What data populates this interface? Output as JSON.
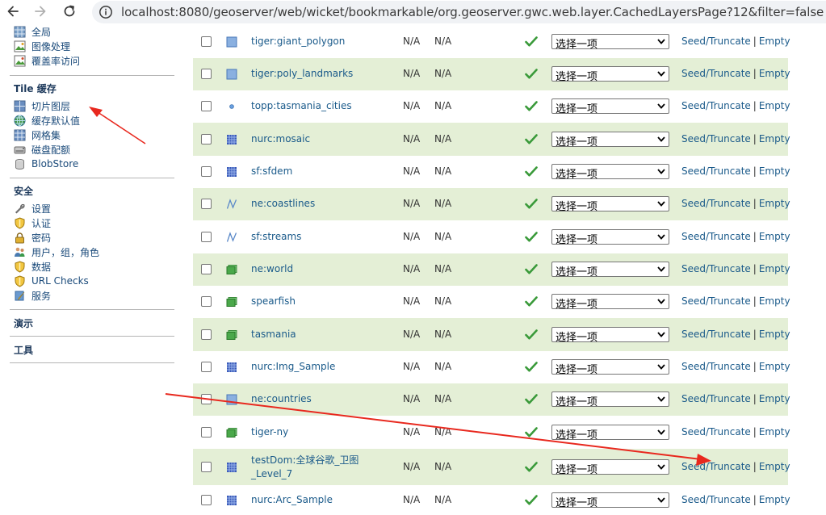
{
  "browser": {
    "url": "localhost:8080/geoserver/web/wicket/bookmarkable/org.geoserver.gwc.web.layer.CachedLayersPage?12&filter=false"
  },
  "sidebar": {
    "top_items": [
      {
        "label": "全局",
        "icon": "globe-icon"
      },
      {
        "label": "图像处理",
        "icon": "image-icon"
      },
      {
        "label": "覆盖率访问",
        "icon": "coverage-icon"
      }
    ],
    "tile_heading": "Tile 缓存",
    "tile_items": [
      {
        "label": "切片图层",
        "icon": "tile-layers-icon"
      },
      {
        "label": "缓存默认值",
        "icon": "globe-icon"
      },
      {
        "label": "网格集",
        "icon": "grid-icon"
      },
      {
        "label": "磁盘配额",
        "icon": "disk-icon"
      },
      {
        "label": "BlobStore",
        "icon": "blobstore-icon"
      }
    ],
    "security_heading": "安全",
    "security_items": [
      {
        "label": "设置",
        "icon": "wrench-icon"
      },
      {
        "label": "认证",
        "icon": "shield-icon"
      },
      {
        "label": "密码",
        "icon": "lock-icon"
      },
      {
        "label": "用户，组，角色",
        "icon": "users-icon"
      },
      {
        "label": "数据",
        "icon": "shield-icon"
      },
      {
        "label": "URL Checks",
        "icon": "shield-icon"
      },
      {
        "label": "服务",
        "icon": "service-icon"
      }
    ],
    "demo_heading": "演示",
    "tools_heading": "工具"
  },
  "table": {
    "select_placeholder": "选择一项",
    "seed_label": "Seed/Truncate",
    "separator": "|",
    "empty_label": "Empty",
    "rows": [
      {
        "name": "tiger:giant_polygon",
        "name2": "",
        "icon": "polygon-icon",
        "c1": "N/A",
        "c2": "N/A"
      },
      {
        "name": "tiger:poly_landmarks",
        "name2": "",
        "icon": "polygon-icon",
        "c1": "N/A",
        "c2": "N/A"
      },
      {
        "name": "topp:tasmania_cities",
        "name2": "",
        "icon": "point-icon",
        "c1": "N/A",
        "c2": "N/A"
      },
      {
        "name": "nurc:mosaic",
        "name2": "",
        "icon": "raster-icon",
        "c1": "N/A",
        "c2": "N/A"
      },
      {
        "name": "sf:sfdem",
        "name2": "",
        "icon": "raster-icon",
        "c1": "N/A",
        "c2": "N/A"
      },
      {
        "name": "ne:coastlines",
        "name2": "",
        "icon": "line-icon",
        "c1": "N/A",
        "c2": "N/A"
      },
      {
        "name": "sf:streams",
        "name2": "",
        "icon": "line-icon",
        "c1": "N/A",
        "c2": "N/A"
      },
      {
        "name": "ne:world",
        "name2": "",
        "icon": "layer-group-icon",
        "c1": "N/A",
        "c2": "N/A"
      },
      {
        "name": "spearfish",
        "name2": "",
        "icon": "layer-group-icon",
        "c1": "N/A",
        "c2": "N/A"
      },
      {
        "name": "tasmania",
        "name2": "",
        "icon": "layer-group-icon",
        "c1": "N/A",
        "c2": "N/A"
      },
      {
        "name": "nurc:Img_Sample",
        "name2": "",
        "icon": "raster-icon",
        "c1": "N/A",
        "c2": "N/A"
      },
      {
        "name": "ne:countries",
        "name2": "",
        "icon": "polygon-icon",
        "c1": "N/A",
        "c2": "N/A"
      },
      {
        "name": "tiger-ny",
        "name2": "",
        "icon": "layer-group-icon",
        "c1": "N/A",
        "c2": "N/A"
      },
      {
        "name": "testDom:全球谷歌_卫图",
        "name2": "_Level_7",
        "icon": "raster-icon",
        "c1": "N/A",
        "c2": "N/A"
      },
      {
        "name": "nurc:Arc_Sample",
        "name2": "",
        "icon": "raster-icon",
        "c1": "N/A",
        "c2": "N/A"
      }
    ]
  },
  "colors": {
    "row_alt": "#e4efd6",
    "link": "#1a5a8a",
    "check": "#3a9a3a",
    "annotation": "#e8281e"
  }
}
